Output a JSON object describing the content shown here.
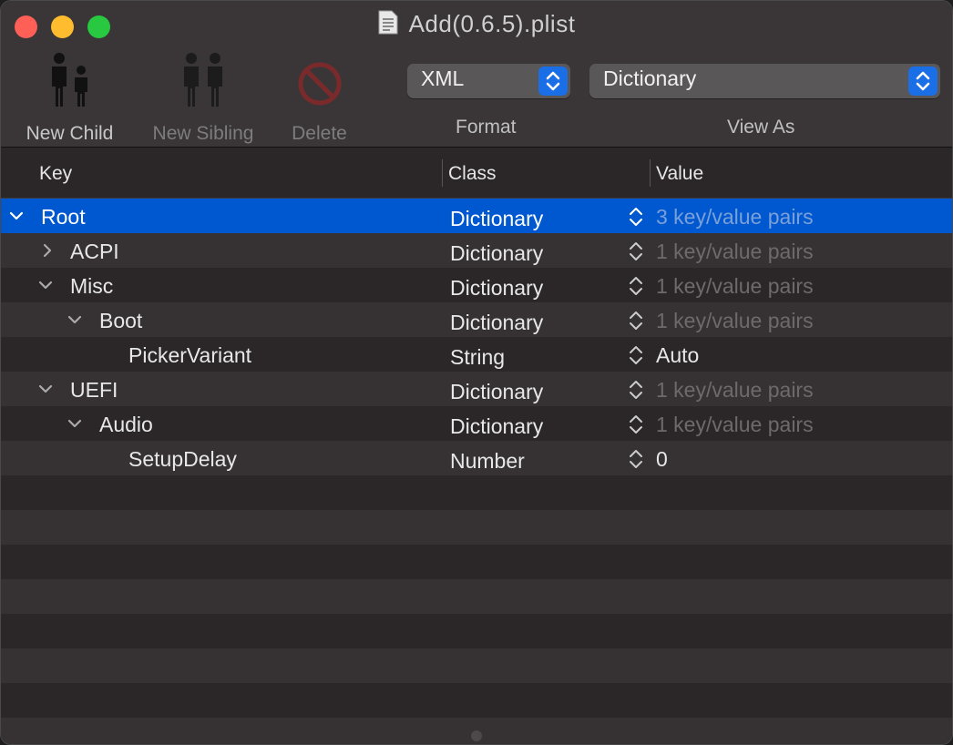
{
  "window": {
    "title": "Add(0.6.5).plist"
  },
  "toolbar": {
    "new_child": "New Child",
    "new_sibling": "New Sibling",
    "delete": "Delete",
    "format_value": "XML",
    "format_label": "Format",
    "view_as_value": "Dictionary",
    "view_as_label": "View As"
  },
  "columns": {
    "key": "Key",
    "class": "Class",
    "value": "Value"
  },
  "rows": [
    {
      "key": "Root",
      "class": "Dictionary",
      "value": "3 key/value pairs"
    },
    {
      "key": "ACPI",
      "class": "Dictionary",
      "value": "1 key/value pairs"
    },
    {
      "key": "Misc",
      "class": "Dictionary",
      "value": "1 key/value pairs"
    },
    {
      "key": "Boot",
      "class": "Dictionary",
      "value": "1 key/value pairs"
    },
    {
      "key": "PickerVariant",
      "class": "String",
      "value": "Auto"
    },
    {
      "key": "UEFI",
      "class": "Dictionary",
      "value": "1 key/value pairs"
    },
    {
      "key": "Audio",
      "class": "Dictionary",
      "value": "1 key/value pairs"
    },
    {
      "key": "SetupDelay",
      "class": "Number",
      "value": "0"
    }
  ],
  "colors": {
    "selection": "#0058d0",
    "accent_button": "#1a6ee6"
  }
}
